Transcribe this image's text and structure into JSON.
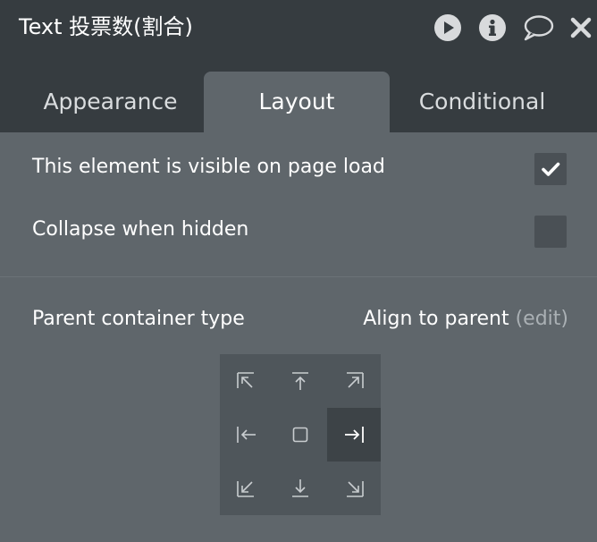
{
  "header": {
    "title": "Text 投票数(割合)",
    "icons": [
      "play-icon",
      "info-icon",
      "comment-icon",
      "close-icon"
    ]
  },
  "tabs": [
    {
      "label": "Appearance",
      "active": false
    },
    {
      "label": "Layout",
      "active": true
    },
    {
      "label": "Conditional",
      "active": false
    }
  ],
  "visibility": {
    "visible_on_load_label": "This element is visible on page load",
    "visible_on_load_checked": true,
    "collapse_when_hidden_label": "Collapse when hidden",
    "collapse_when_hidden_checked": false
  },
  "container": {
    "label": "Parent container type",
    "value": "Align to parent",
    "edit_label": "(edit)"
  },
  "alignment": {
    "cells": [
      "top-left",
      "top-center",
      "top-right",
      "middle-left",
      "center",
      "middle-right",
      "bottom-left",
      "bottom-center",
      "bottom-right"
    ],
    "selected": "middle-right"
  },
  "colors": {
    "header_bg": "#363c40",
    "panel_bg": "#5f666b",
    "checkbox_bg": "#4a5055",
    "grid_bg": "#4f565b",
    "selected_cell_bg": "#3d4347",
    "muted_text": "#aab0b4"
  }
}
